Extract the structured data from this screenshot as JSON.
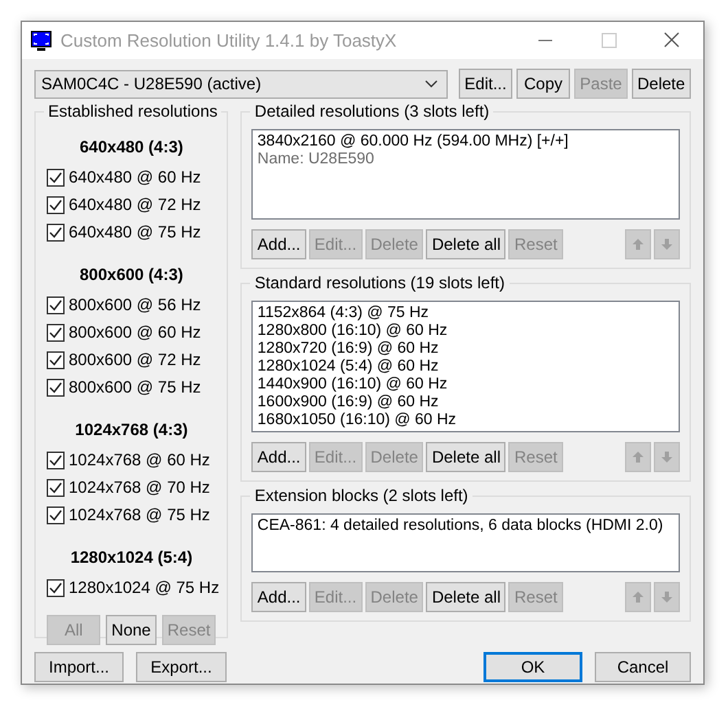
{
  "window": {
    "title": "Custom Resolution Utility 1.4.1 by ToastyX"
  },
  "monitor_dropdown": {
    "value": "SAM0C4C - U28E590 (active)"
  },
  "top_buttons": [
    {
      "label": "Edit...",
      "disabled": false
    },
    {
      "label": "Copy",
      "disabled": false
    },
    {
      "label": "Paste",
      "disabled": true
    },
    {
      "label": "Delete",
      "disabled": false
    }
  ],
  "established": {
    "title": "Established resolutions",
    "groups": [
      {
        "heading": "640x480 (4:3)",
        "items": [
          {
            "label": "640x480 @ 60 Hz",
            "checked": true
          },
          {
            "label": "640x480 @ 72 Hz",
            "checked": true
          },
          {
            "label": "640x480 @ 75 Hz",
            "checked": true
          }
        ]
      },
      {
        "heading": "800x600 (4:3)",
        "items": [
          {
            "label": "800x600 @ 56 Hz",
            "checked": true
          },
          {
            "label": "800x600 @ 60 Hz",
            "checked": true
          },
          {
            "label": "800x600 @ 72 Hz",
            "checked": true
          },
          {
            "label": "800x600 @ 75 Hz",
            "checked": true
          }
        ]
      },
      {
        "heading": "1024x768 (4:3)",
        "items": [
          {
            "label": "1024x768 @ 60 Hz",
            "checked": true
          },
          {
            "label": "1024x768 @ 70 Hz",
            "checked": true
          },
          {
            "label": "1024x768 @ 75 Hz",
            "checked": true
          }
        ]
      },
      {
        "heading": "1280x1024 (5:4)",
        "items": [
          {
            "label": "1280x1024 @ 75 Hz",
            "checked": true
          }
        ]
      }
    ],
    "buttons": [
      {
        "label": "All",
        "disabled": true
      },
      {
        "label": "None",
        "disabled": false
      },
      {
        "label": "Reset",
        "disabled": true
      }
    ]
  },
  "sections": [
    {
      "title": "Detailed resolutions (3 slots left)",
      "items": [
        {
          "text": "3840x2160 @ 60.000 Hz (594.00 MHz) [+/+]",
          "kind": "entry"
        },
        {
          "text": "Name: U28E590",
          "kind": "note"
        }
      ],
      "buttons": [
        {
          "label": "Add...",
          "disabled": false
        },
        {
          "label": "Edit...",
          "disabled": true
        },
        {
          "label": "Delete",
          "disabled": true
        },
        {
          "label": "Delete all",
          "disabled": false
        },
        {
          "label": "Reset",
          "disabled": true
        }
      ],
      "arrows_disabled": true
    },
    {
      "title": "Standard resolutions (19 slots left)",
      "items": [
        {
          "text": "1152x864 (4:3) @ 75 Hz",
          "kind": "entry"
        },
        {
          "text": "1280x800 (16:10) @ 60 Hz",
          "kind": "entry"
        },
        {
          "text": "1280x720 (16:9) @ 60 Hz",
          "kind": "entry"
        },
        {
          "text": "1280x1024 (5:4) @ 60 Hz",
          "kind": "entry"
        },
        {
          "text": "1440x900 (16:10) @ 60 Hz",
          "kind": "entry"
        },
        {
          "text": "1600x900 (16:9) @ 60 Hz",
          "kind": "entry"
        },
        {
          "text": "1680x1050 (16:10) @ 60 Hz",
          "kind": "entry"
        }
      ],
      "buttons": [
        {
          "label": "Add...",
          "disabled": false
        },
        {
          "label": "Edit...",
          "disabled": true
        },
        {
          "label": "Delete",
          "disabled": true
        },
        {
          "label": "Delete all",
          "disabled": false
        },
        {
          "label": "Reset",
          "disabled": true
        }
      ],
      "arrows_disabled": true
    },
    {
      "title": "Extension blocks (2 slots left)",
      "items": [
        {
          "text": "CEA-861: 4 detailed resolutions, 6 data blocks (HDMI 2.0)",
          "kind": "entry"
        }
      ],
      "buttons": [
        {
          "label": "Add...",
          "disabled": false
        },
        {
          "label": "Edit...",
          "disabled": true
        },
        {
          "label": "Delete",
          "disabled": true
        },
        {
          "label": "Delete all",
          "disabled": false
        },
        {
          "label": "Reset",
          "disabled": true
        }
      ],
      "arrows_disabled": true
    }
  ],
  "bottom_left_buttons": [
    {
      "label": "Import...",
      "default": false
    },
    {
      "label": "Export...",
      "default": false
    }
  ],
  "bottom_right_buttons": [
    {
      "label": "OK",
      "default": true
    },
    {
      "label": "Cancel",
      "default": false
    }
  ]
}
